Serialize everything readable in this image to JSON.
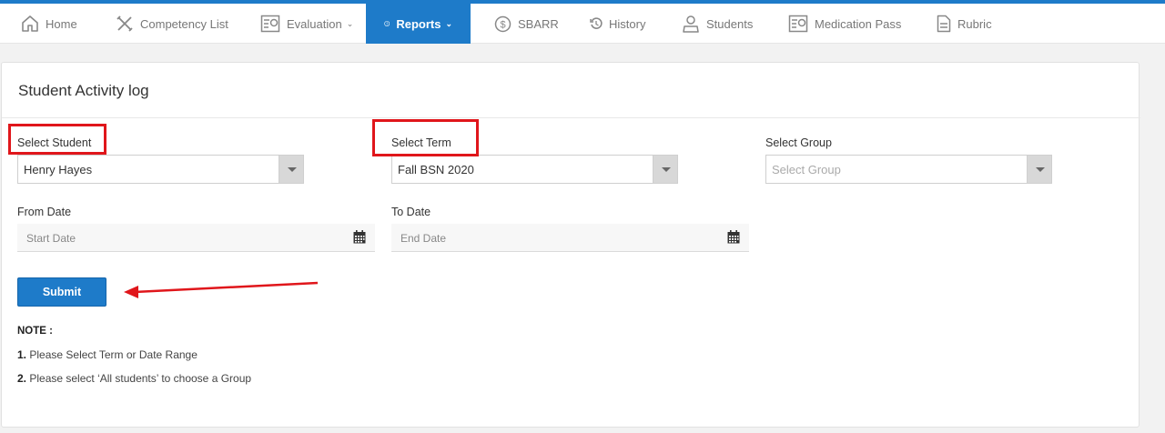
{
  "nav": {
    "items": [
      {
        "label": "Home"
      },
      {
        "label": "Competency List"
      },
      {
        "label": "Evaluation"
      },
      {
        "label": "Reports"
      },
      {
        "label": "SBARR"
      },
      {
        "label": "History"
      },
      {
        "label": "Students"
      },
      {
        "label": "Medication Pass"
      },
      {
        "label": "Rubric"
      }
    ],
    "active": "Reports",
    "accent_color": "#1e7bc9"
  },
  "page": {
    "title": "Student Activity log"
  },
  "form": {
    "student": {
      "label": "Select Student",
      "value": "Henry Hayes"
    },
    "term": {
      "label": "Select Term",
      "value": "Fall BSN 2020"
    },
    "group": {
      "label": "Select Group",
      "placeholder": "Select Group"
    },
    "from_date": {
      "label": "From Date",
      "placeholder": "Start Date"
    },
    "to_date": {
      "label": "To Date",
      "placeholder": "End Date"
    },
    "submit_label": "Submit"
  },
  "notes": {
    "title": "NOTE :",
    "items": [
      {
        "num": "1.",
        "text": "Please Select Term or Date Range"
      },
      {
        "num": "2.",
        "text": "Please select ‘All students’ to choose a Group"
      }
    ]
  },
  "annotation_color": "#e0161b"
}
